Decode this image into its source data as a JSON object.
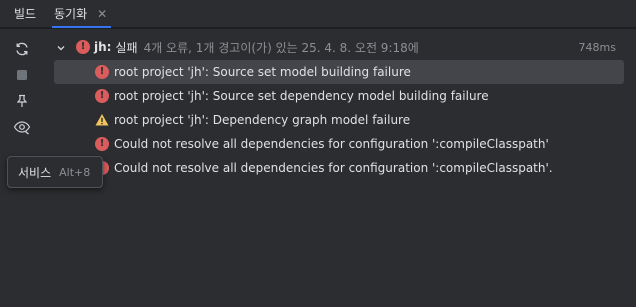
{
  "tabs": [
    {
      "label": "빌드"
    },
    {
      "label": "동기화",
      "close": "✕"
    }
  ],
  "tree": {
    "root": {
      "name": "jh:",
      "status": "실패",
      "meta": "4개 오류, 1개 경고이(가) 있는 25. 4. 8. 오전 9:18에",
      "duration": "748ms",
      "status_color": "#db5c5c"
    },
    "items": [
      {
        "level": "error",
        "message": "root project 'jh': Source set model building failure"
      },
      {
        "level": "error",
        "message": "root project 'jh': Source set dependency model building failure"
      },
      {
        "level": "warning",
        "message": "root project 'jh': Dependency graph model failure"
      },
      {
        "level": "error",
        "message": "Could not resolve all dependencies for configuration ':compileClasspath'"
      },
      {
        "level": "error",
        "message": "Could not resolve all dependencies for configuration ':compileClasspath'."
      }
    ]
  },
  "toolbar": {
    "icons": [
      "sync-icon",
      "stop-icon",
      "pin-icon",
      "eye-icon"
    ]
  },
  "tooltip": {
    "label": "서비스",
    "shortcut": "Alt+8"
  },
  "colors": {
    "error": "#db5c5c",
    "warning": "#f2c55c",
    "accent": "#3574f0",
    "background": "#2b2d30",
    "selection": "#43454a"
  }
}
